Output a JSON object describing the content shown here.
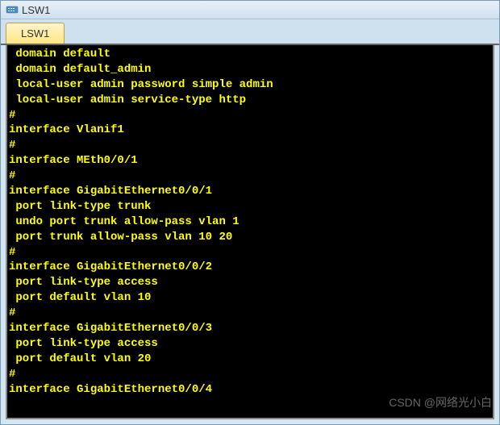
{
  "window": {
    "title": "LSW1"
  },
  "tabs": [
    {
      "label": "LSW1"
    }
  ],
  "terminal": {
    "lines": [
      " domain default",
      " domain default_admin",
      " local-user admin password simple admin",
      " local-user admin service-type http",
      "#",
      "interface Vlanif1",
      "#",
      "interface MEth0/0/1",
      "#",
      "interface GigabitEthernet0/0/1",
      " port link-type trunk",
      " undo port trunk allow-pass vlan 1",
      " port trunk allow-pass vlan 10 20",
      "#",
      "interface GigabitEthernet0/0/2",
      " port link-type access",
      " port default vlan 10",
      "#",
      "interface GigabitEthernet0/0/3",
      " port link-type access",
      " port default vlan 20",
      "#",
      "interface GigabitEthernet0/0/4"
    ]
  },
  "watermark": "CSDN @网络光小白"
}
